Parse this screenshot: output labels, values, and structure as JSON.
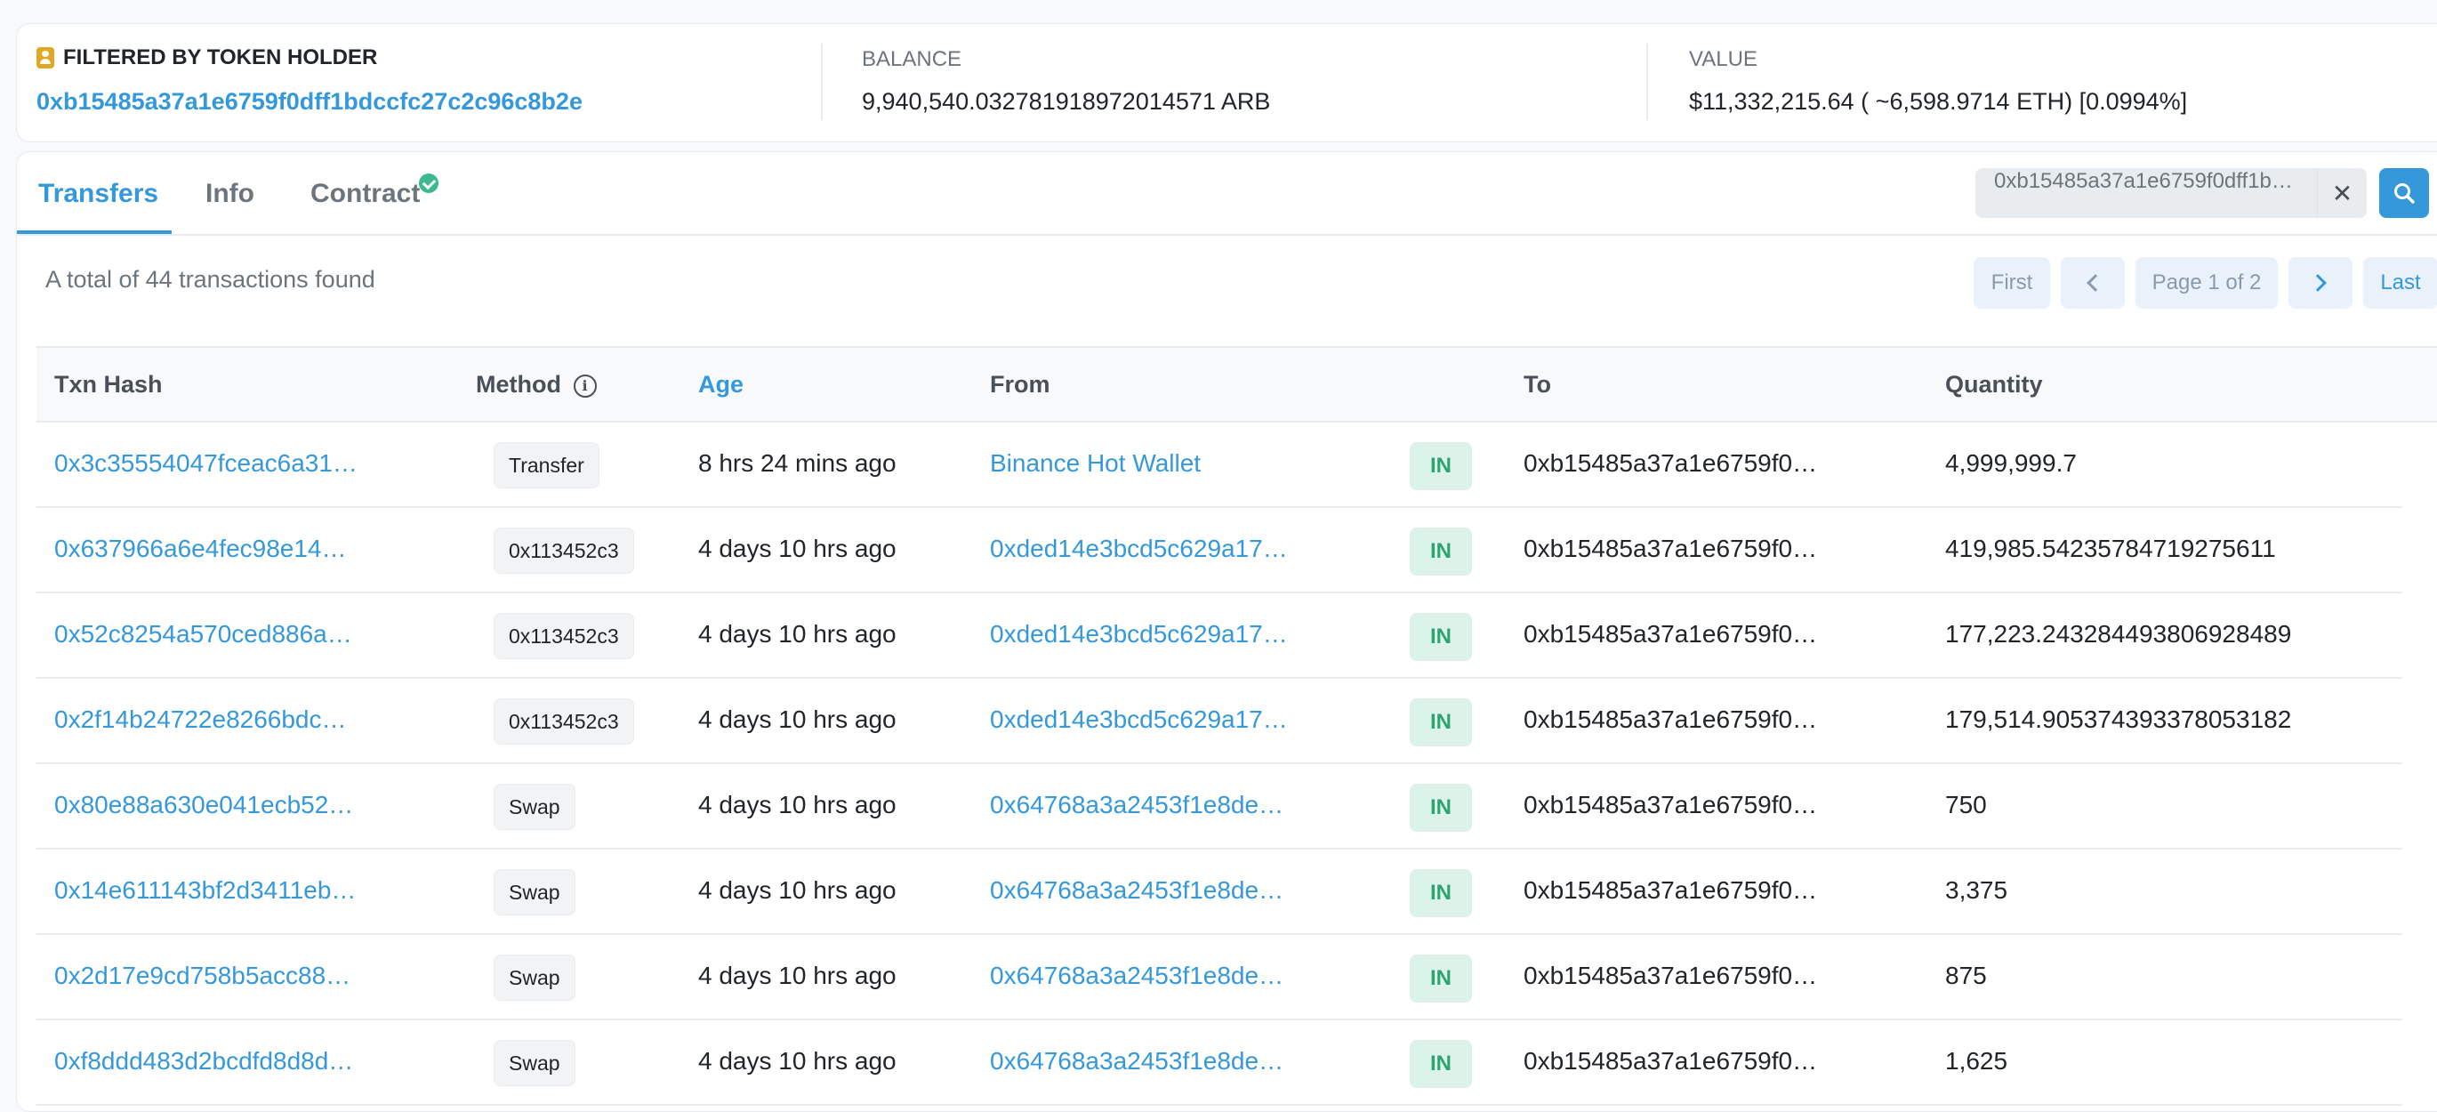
{
  "summary": {
    "holder_label": "FILTERED BY TOKEN HOLDER",
    "holder_address": "0xb15485a37a1e6759f0dff1bdccfc27c2c96c8b2e",
    "balance_label": "BALANCE",
    "balance_value": "9,940,540.032781918972014571 ARB",
    "value_label": "VALUE",
    "value_value": "$11,332,215.64 ( ~6,598.9714 ETH) [0.0994%]"
  },
  "tabs": [
    {
      "label": "Transfers"
    },
    {
      "label": "Info"
    },
    {
      "label": "Contract"
    }
  ],
  "search": {
    "value": "0xb15485a37a1e6759f0dff1b…",
    "clear_label": "✕"
  },
  "total_text": "A total of 44 transactions found",
  "pager": {
    "first": "First",
    "page_label": "Page 1 of 2",
    "last": "Last"
  },
  "columns": {
    "txn_hash": "Txn Hash",
    "method": "Method",
    "age": "Age",
    "from": "From",
    "to": "To",
    "quantity": "Quantity"
  },
  "rows": [
    {
      "hash": "0x3c35554047fceac6a31…",
      "method": "Transfer",
      "age": "8 hrs 24 mins ago",
      "from": "Binance Hot Wallet",
      "dir": "IN",
      "to": "0xb15485a37a1e6759f0…",
      "qty": "4,999,999.7"
    },
    {
      "hash": "0x637966a6e4fec98e14…",
      "method": "0x113452c3",
      "age": "4 days 10 hrs ago",
      "from": "0xded14e3bcd5c629a17…",
      "dir": "IN",
      "to": "0xb15485a37a1e6759f0…",
      "qty": "419,985.54235784719275611"
    },
    {
      "hash": "0x52c8254a570ced886a…",
      "method": "0x113452c3",
      "age": "4 days 10 hrs ago",
      "from": "0xded14e3bcd5c629a17…",
      "dir": "IN",
      "to": "0xb15485a37a1e6759f0…",
      "qty": "177,223.243284493806928489"
    },
    {
      "hash": "0x2f14b24722e8266bdc…",
      "method": "0x113452c3",
      "age": "4 days 10 hrs ago",
      "from": "0xded14e3bcd5c629a17…",
      "dir": "IN",
      "to": "0xb15485a37a1e6759f0…",
      "qty": "179,514.905374393378053182"
    },
    {
      "hash": "0x80e88a630e041ecb52…",
      "method": "Swap",
      "age": "4 days 10 hrs ago",
      "from": "0x64768a3a2453f1e8de…",
      "dir": "IN",
      "to": "0xb15485a37a1e6759f0…",
      "qty": "750"
    },
    {
      "hash": "0x14e611143bf2d3411eb…",
      "method": "Swap",
      "age": "4 days 10 hrs ago",
      "from": "0x64768a3a2453f1e8de…",
      "dir": "IN",
      "to": "0xb15485a37a1e6759f0…",
      "qty": "3,375"
    },
    {
      "hash": "0x2d17e9cd758b5acc88…",
      "method": "Swap",
      "age": "4 days 10 hrs ago",
      "from": "0x64768a3a2453f1e8de…",
      "dir": "IN",
      "to": "0xb15485a37a1e6759f0…",
      "qty": "875"
    },
    {
      "hash": "0xf8ddd483d2bcdfd8d8d…",
      "method": "Swap",
      "age": "4 days 10 hrs ago",
      "from": "0x64768a3a2453f1e8de…",
      "dir": "IN",
      "to": "0xb15485a37a1e6759f0…",
      "qty": "1,625"
    }
  ]
}
